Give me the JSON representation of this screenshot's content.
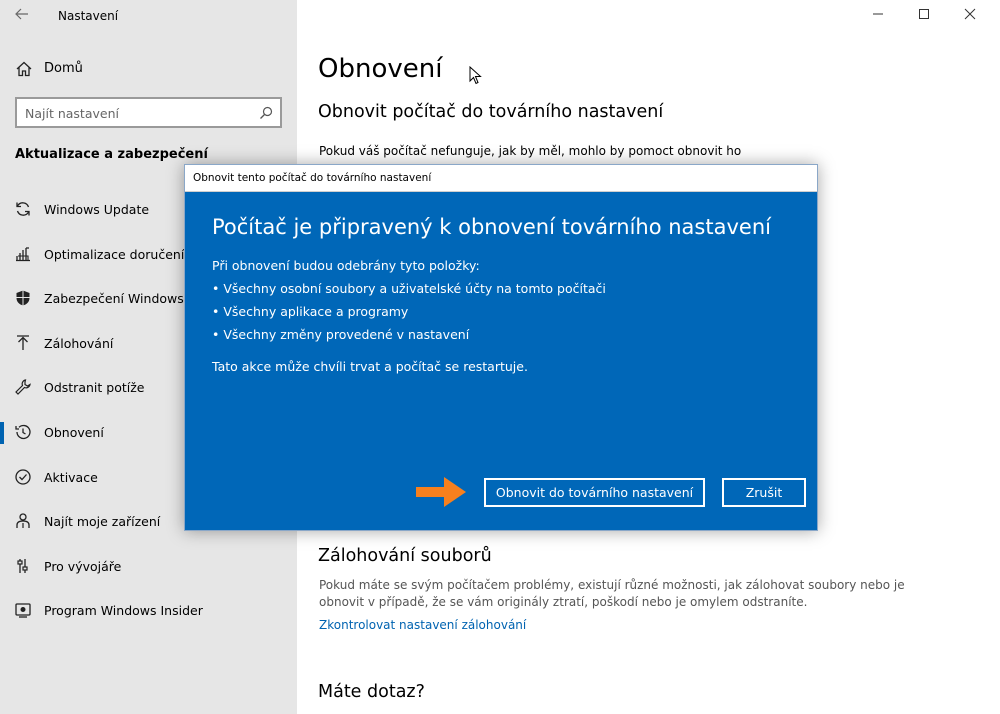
{
  "app": {
    "title": "Nastavení"
  },
  "sidebar": {
    "home_label": "Domů",
    "search_placeholder": "Najít nastavení",
    "section_title": "Aktualizace a zabezpečení",
    "items": [
      {
        "label": "Windows Update",
        "icon": "refresh-icon"
      },
      {
        "label": "Optimalizace doručení",
        "icon": "delivery-optimization-icon"
      },
      {
        "label": "Zabezpečení Windows",
        "icon": "shield-icon"
      },
      {
        "label": "Zálohování",
        "icon": "upload-arrow-icon"
      },
      {
        "label": "Odstranit potíže",
        "icon": "wrench-icon"
      },
      {
        "label": "Obnovení",
        "icon": "history-icon",
        "active": true
      },
      {
        "label": "Aktivace",
        "icon": "check-circle-icon"
      },
      {
        "label": "Najít moje zařízení",
        "icon": "person-location-icon"
      },
      {
        "label": "Pro vývojáře",
        "icon": "developer-sliders-icon"
      },
      {
        "label": "Program Windows Insider",
        "icon": "insider-icon"
      }
    ]
  },
  "main": {
    "page_title": "Obnovení",
    "reset_title": "Obnovit počítač do továrního nastavení",
    "reset_text": "Pokud váš počítač nefunguje, jak by měl, mohlo by pomoct obnovit ho",
    "backup_title": "Zálohování souborů",
    "backup_text": "Pokud máte se svým počítačem problémy, existují různé možnosti, jak zálohovat soubory nebo je obnovit v případě, že se vám originály ztratí, poškodí nebo je omylem odstraníte.",
    "backup_link": "Zkontrolovat nastavení zálohování",
    "question_title": "Máte dotaz?"
  },
  "dialog": {
    "window_title": "Obnovit tento počítač do továrního nastavení",
    "heading": "Počítač je připravený k obnovení továrního nastavení",
    "intro": "Při obnovení budou odebrány tyto položky:",
    "bullets": [
      "• Všechny osobní soubory a uživatelské účty na tomto počítači",
      "• Všechny aplikace a programy",
      "• Všechny změny provedené v nastavení"
    ],
    "note": "Tato akce může chvíli trvat a počítač se restartuje.",
    "reset_button": "Obnovit do továrního nastavení",
    "cancel_button": "Zrušit"
  },
  "colors": {
    "dialog_bg": "#0067b8",
    "accent": "#0063b1",
    "sidebar_bg": "#e6e6e6",
    "arrow": "#f7801e"
  }
}
